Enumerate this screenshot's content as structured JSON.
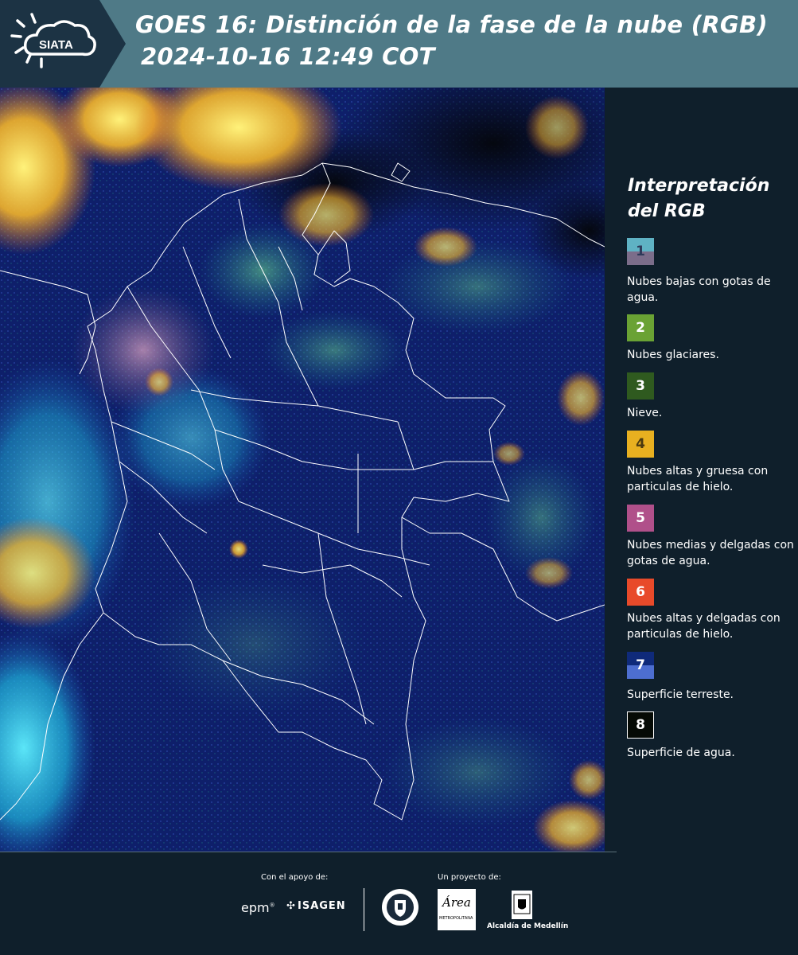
{
  "header": {
    "logo_text": "SIATA",
    "title_line1": "GOES 16: Distinción de la fase de la nube (RGB)",
    "title_line2": "2024-10-16 12:49 COT"
  },
  "legend": {
    "title": "Interpretación del RGB",
    "items": [
      {
        "number": "1",
        "label": "Nubes bajas con gotas de agua.",
        "colors": [
          "#5fb2c4",
          "#7b6d8a"
        ]
      },
      {
        "number": "2",
        "label": "Nubes glaciares.",
        "colors": [
          "#6aa234"
        ]
      },
      {
        "number": "3",
        "label": "Nieve.",
        "colors": [
          "#2f5a1f"
        ]
      },
      {
        "number": "4",
        "label": "Nubes altas y gruesa con particulas de hielo.",
        "colors": [
          "#e8b020"
        ]
      },
      {
        "number": "5",
        "label": "Nubes medias y delgadas con gotas de agua.",
        "colors": [
          "#b0508a"
        ]
      },
      {
        "number": "6",
        "label": "Nubes altas y delgadas con particulas de hielo.",
        "colors": [
          "#e84a2a"
        ]
      },
      {
        "number": "7",
        "label": "Superficie terreste.",
        "colors": [
          "#0f2a7a",
          "#4d6ed0"
        ]
      },
      {
        "number": "8",
        "label": "Superficie de agua.",
        "colors": [
          "#050a05"
        ]
      }
    ]
  },
  "footer": {
    "support_caption": "Con el apoyo de:",
    "project_caption": "Un proyecto de:",
    "epm_label": "epm",
    "isagen_label": "ISAGEN",
    "area_label": "Área",
    "area_sub": "METROPOLITANA",
    "alcaldia_label": "Alcaldía de Medellín"
  }
}
